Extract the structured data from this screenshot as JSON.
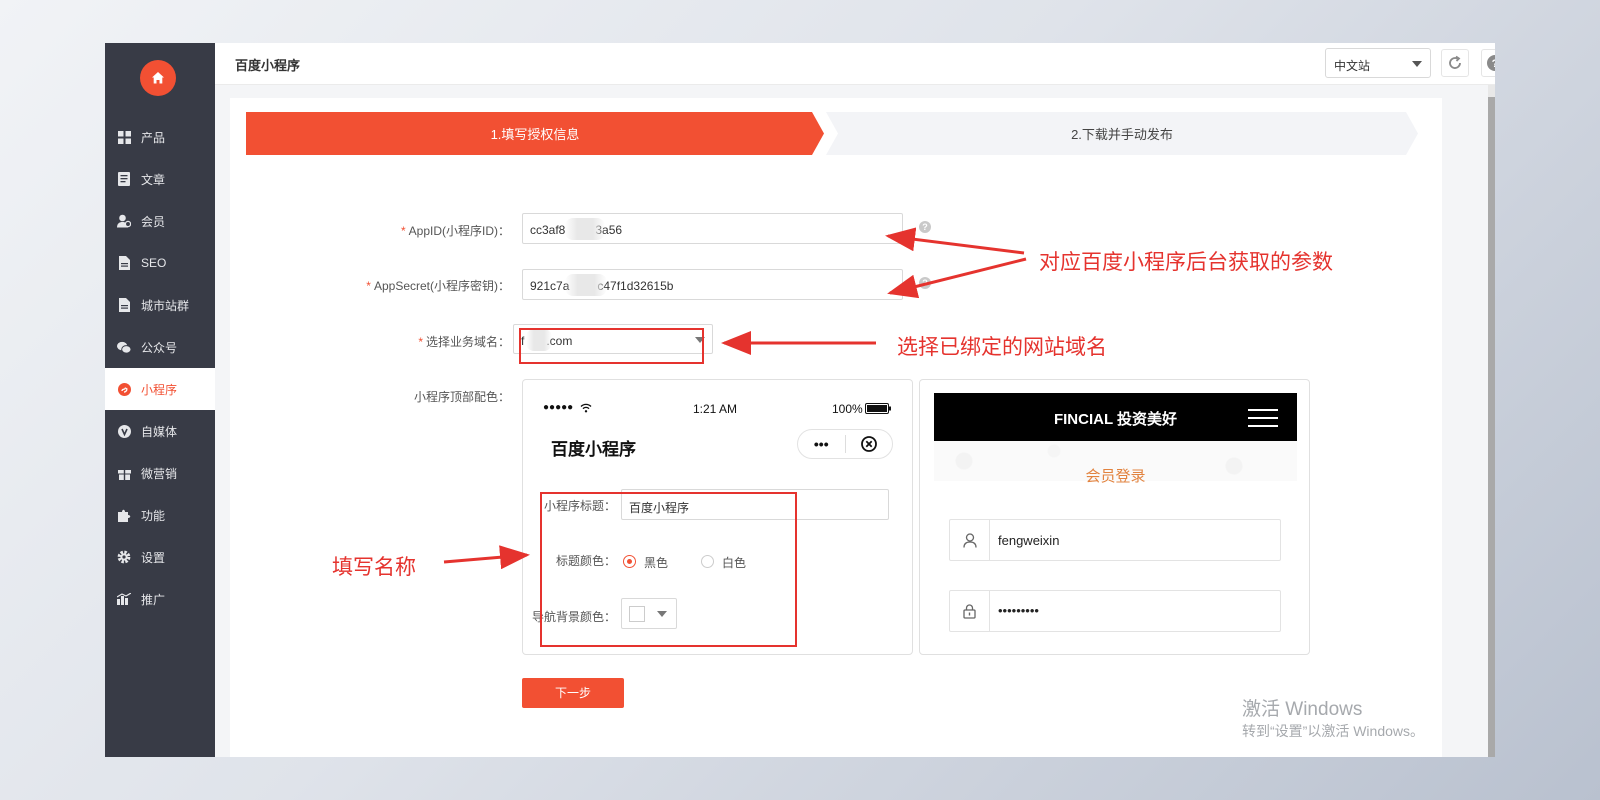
{
  "sidebar": {
    "items": [
      {
        "label": "产品",
        "icon": "grid-icon"
      },
      {
        "label": "文章",
        "icon": "document-icon"
      },
      {
        "label": "会员",
        "icon": "user-icon"
      },
      {
        "label": "SEO",
        "icon": "file-icon"
      },
      {
        "label": "城市站群",
        "icon": "file-icon"
      },
      {
        "label": "公众号",
        "icon": "wechat-icon"
      },
      {
        "label": "小程序",
        "icon": "miniprogram-icon",
        "active": true
      },
      {
        "label": "自媒体",
        "icon": "v-icon"
      },
      {
        "label": "微营销",
        "icon": "gift-icon"
      },
      {
        "label": "功能",
        "icon": "puzzle-icon"
      },
      {
        "label": "设置",
        "icon": "gear-icon"
      },
      {
        "label": "推广",
        "icon": "chart-icon"
      }
    ]
  },
  "header": {
    "title": "百度小程序",
    "language": "中文站"
  },
  "steps": {
    "step1": "1.填写授权信息",
    "step2": "2.下载并手动发布"
  },
  "form": {
    "appid_label": "AppID(小程序ID)：",
    "appid_value_prefix": "cc3af8",
    "appid_value_suffix": "3a56",
    "secret_label": "AppSecret(小程序密钥)：",
    "secret_value_prefix": "921c7a",
    "secret_value_suffix": "c47f1d32615b",
    "domain_label": "选择业务域名：",
    "domain_value_prefix": "f",
    "domain_value_suffix": ".com",
    "color_label": "小程序顶部配色："
  },
  "phone_preview": {
    "signal": "●●●●● ",
    "time": "1:21 AM",
    "battery": "100%",
    "title": "百度小程序",
    "capsule_dots": "•••",
    "title_label": "小程序标题：",
    "title_value": "百度小程序",
    "title_color_label": "标题颜色：",
    "color_black": "黑色",
    "color_white": "白色",
    "nav_bg_label": "导航背景颜色："
  },
  "login_preview": {
    "brand": "FINCIAL 投资美好",
    "subtitle": "会员登录",
    "username": "fengweixin",
    "password": "•••••••••"
  },
  "buttons": {
    "next": "下一步"
  },
  "annotations": {
    "params": "对应百度小程序后台获取的参数",
    "domain": "选择已绑定的网站域名",
    "name": "填写名称"
  },
  "watermark": {
    "line1": "激活 Windows",
    "line2": "转到“设置”以激活 Windows。"
  },
  "colors": {
    "accent": "#f25033",
    "sidebar_bg": "#383b46",
    "annotation": "#e5332e"
  }
}
